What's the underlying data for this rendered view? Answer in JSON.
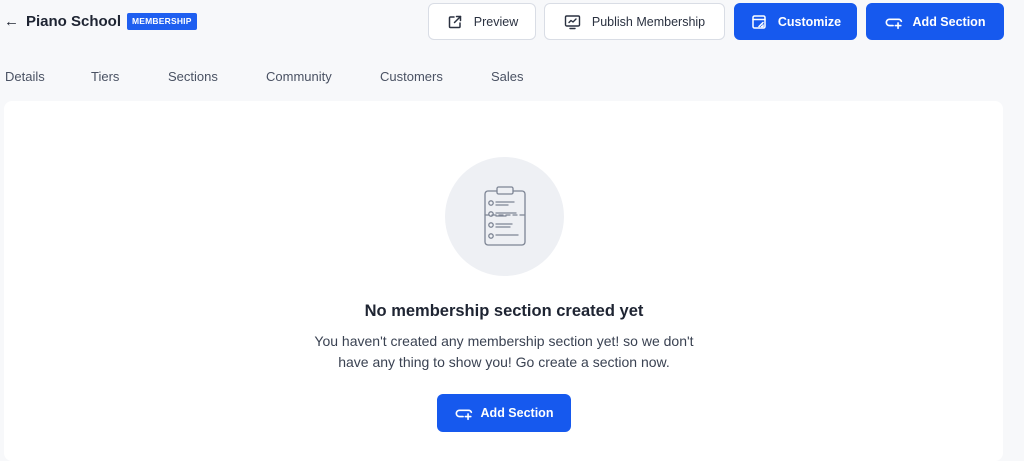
{
  "header": {
    "back_icon": "arrow-left-icon",
    "title": "Piano School",
    "badge": "MEMBERSHIP"
  },
  "toolbar": {
    "preview_label": "Preview",
    "preview_icon": "external-link-icon",
    "publish_label": "Publish Membership",
    "publish_icon": "monitor-upload-icon",
    "customize_label": "Customize",
    "customize_icon": "customize-window-icon",
    "add_section_label": "Add Section",
    "add_section_icon": "add-section-icon"
  },
  "tabs": [
    {
      "label": "Details"
    },
    {
      "label": "Tiers"
    },
    {
      "label": "Sections"
    },
    {
      "label": "Community"
    },
    {
      "label": "Customers"
    },
    {
      "label": "Sales"
    }
  ],
  "empty_state": {
    "icon": "clipboard-checklist-icon",
    "title": "No membership section created yet",
    "description_line1": "You haven't created any membership section yet! so we don't",
    "description_line2": "have any thing to show you! Go create a section now.",
    "button_label": "Add Section"
  },
  "colors": {
    "primary": "#1659ee",
    "badge": "#1f5ff0",
    "page_background": "#f7f8fa",
    "card_background": "#ffffff"
  }
}
